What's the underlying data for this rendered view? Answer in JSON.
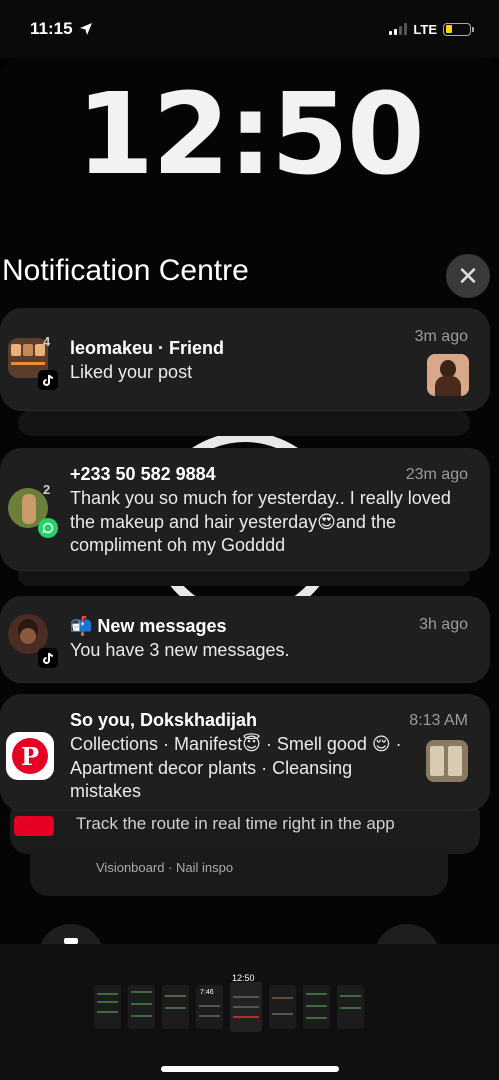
{
  "status_bar": {
    "time": "11:15",
    "network": "LTE"
  },
  "lock": {
    "time": "12:50",
    "section_title": "Notification Centre",
    "close_glyph": "✕"
  },
  "notifications": [
    {
      "app": "TikTok",
      "count": "4",
      "title": "leomakeu · Friend",
      "body": "Liked your post",
      "time": "3m ago"
    },
    {
      "app": "WhatsApp",
      "count": "2",
      "title": "+233 50 582 9884",
      "body": "Thank you so much for yesterday.. I really loved the makeup and hair yesterday😍and the compliment oh my Godddd",
      "time": "23m ago"
    },
    {
      "app": "TikTok",
      "title": "📬 New messages",
      "body": "You have 3 new messages.",
      "time": "3h ago"
    },
    {
      "app": "Pinterest",
      "title": "So you, Dokskhadijah",
      "body": "Collections · Manifest😇 · Smell good 😌 · Apartment decor plants · Cleansing mistakes",
      "time": "8:13 AM"
    }
  ],
  "stacked": {
    "line1": "Track the route in real time right in the app",
    "line2": "Visionboard · Nail inspo"
  },
  "tray": {
    "active_label": "12:50",
    "second_label": "7:46"
  }
}
